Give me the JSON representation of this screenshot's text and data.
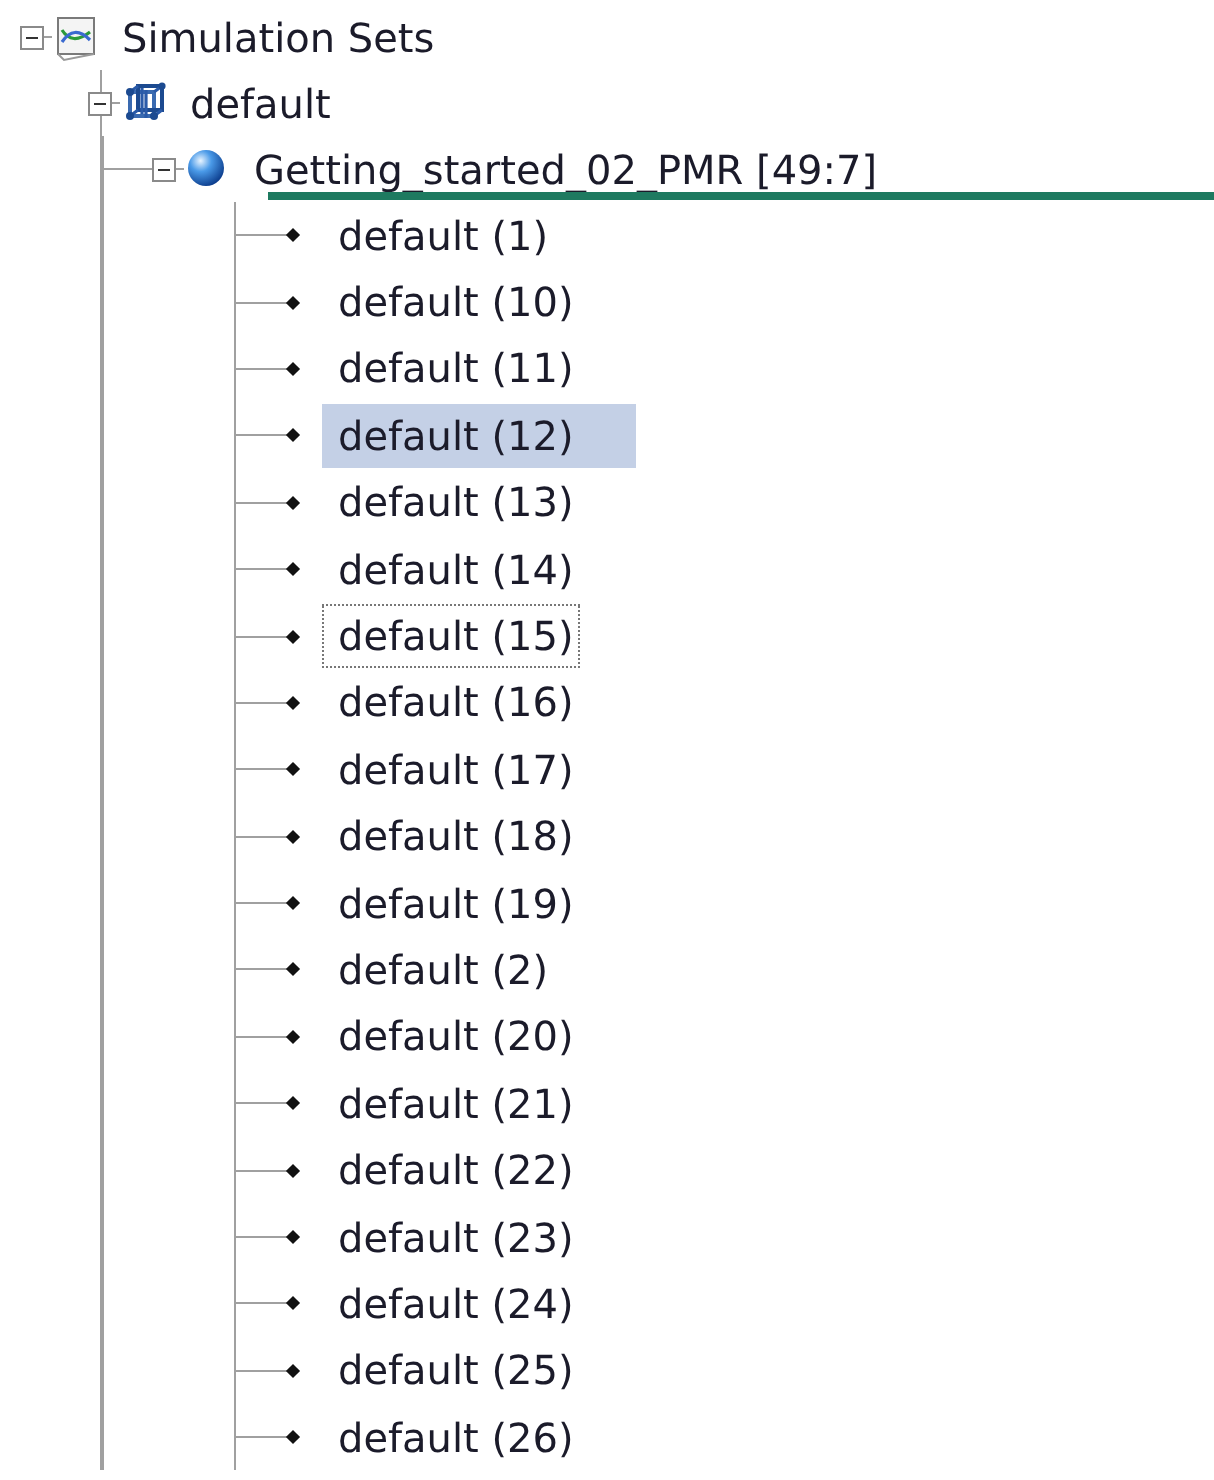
{
  "tree": [
    {
      "label": "Simulation Sets",
      "kind": "simulation-sets",
      "expanded": true,
      "children": [
        {
          "label": "default",
          "kind": "model",
          "expanded": true,
          "children": [
            {
              "label": "Getting_started_02_PMR [49:7]",
              "kind": "sphere",
              "expanded": true,
              "drop_indicator": true,
              "children": [
                {
                  "label": "default (1)",
                  "kind": "leaf",
                  "selected": false,
                  "focused": false
                },
                {
                  "label": "default (10)",
                  "kind": "leaf",
                  "selected": false,
                  "focused": false
                },
                {
                  "label": "default (11)",
                  "kind": "leaf",
                  "selected": false,
                  "focused": false
                },
                {
                  "label": "default (12)",
                  "kind": "leaf",
                  "selected": true,
                  "focused": false
                },
                {
                  "label": "default (13)",
                  "kind": "leaf",
                  "selected": false,
                  "focused": false
                },
                {
                  "label": "default (14)",
                  "kind": "leaf",
                  "selected": false,
                  "focused": false
                },
                {
                  "label": "default (15)",
                  "kind": "leaf",
                  "selected": false,
                  "focused": true
                },
                {
                  "label": "default (16)",
                  "kind": "leaf",
                  "selected": false,
                  "focused": false
                },
                {
                  "label": "default (17)",
                  "kind": "leaf",
                  "selected": false,
                  "focused": false
                },
                {
                  "label": "default (18)",
                  "kind": "leaf",
                  "selected": false,
                  "focused": false
                },
                {
                  "label": "default (19)",
                  "kind": "leaf",
                  "selected": false,
                  "focused": false
                },
                {
                  "label": "default (2)",
                  "kind": "leaf",
                  "selected": false,
                  "focused": false
                },
                {
                  "label": "default (20)",
                  "kind": "leaf",
                  "selected": false,
                  "focused": false
                },
                {
                  "label": "default (21)",
                  "kind": "leaf",
                  "selected": false,
                  "focused": false
                },
                {
                  "label": "default (22)",
                  "kind": "leaf",
                  "selected": false,
                  "focused": false
                },
                {
                  "label": "default (23)",
                  "kind": "leaf",
                  "selected": false,
                  "focused": false
                },
                {
                  "label": "default (24)",
                  "kind": "leaf",
                  "selected": false,
                  "focused": false
                },
                {
                  "label": "default (25)",
                  "kind": "leaf",
                  "selected": false,
                  "focused": false
                },
                {
                  "label": "default (26)",
                  "kind": "leaf",
                  "selected": false,
                  "focused": false
                }
              ]
            }
          ]
        }
      ]
    }
  ]
}
